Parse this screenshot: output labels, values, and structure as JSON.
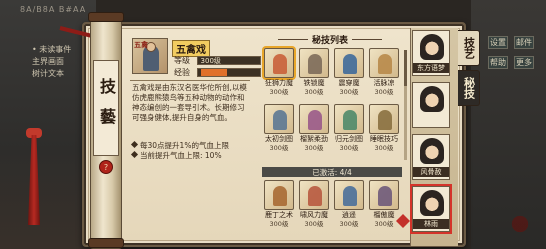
{
  "background": {
    "top_text": "8A/B8A B#AA",
    "left_list": [
      "• 未读事件",
      "主界画面",
      "树计文本"
    ],
    "right_menu": [
      "设置",
      "邮件",
      "帮助",
      "更多"
    ]
  },
  "rod": {
    "title": "技藝",
    "seal": "?"
  },
  "skill": {
    "portrait_label": "五禽",
    "name": "五禽戏",
    "level_label": "等级",
    "level_value": "300级",
    "exp_label": "经验",
    "exp_value": "",
    "exp_fill_pct": 45,
    "description": "五禽戏是由东汉名医华佗所创,以模仿虎鹿熊猿鸟等五种动物的动作和神态编创的一套导引术。长期修习可强身健体,提升自身的气血。",
    "effects": [
      "每30点提升1%的气血上限",
      "当前提升气血上限: 10%"
    ]
  },
  "secret_list": {
    "title": "秘技列表",
    "items": [
      {
        "name": "狂狮力魔",
        "level": "300级",
        "color": "#c9603a"
      },
      {
        "name": "铁锁魔",
        "level": "300级",
        "color": "#7d6b5a"
      },
      {
        "name": "震穿魔",
        "level": "300级",
        "color": "#3f6a9a"
      },
      {
        "name": "活脉凉",
        "level": "300级",
        "color": "#b88a4a"
      },
      {
        "name": "太初剑图",
        "level": "300级",
        "color": "#5c7894"
      },
      {
        "name": "榴絮柔劲",
        "level": "300级",
        "color": "#9a5a8a"
      },
      {
        "name": "归元剑图",
        "level": "300级",
        "color": "#4f8a6a"
      },
      {
        "name": "睡眠技巧",
        "level": "300级",
        "color": "#8a7040"
      }
    ],
    "activated_label": "已激活: 4/4",
    "active": [
      {
        "name": "鹿丁之术",
        "level": "300级",
        "color": "#a86a34"
      },
      {
        "name": "啸风力魔",
        "level": "300级",
        "color": "#b85a40"
      },
      {
        "name": "逍遥",
        "level": "300级",
        "color": "#4a6f9a"
      },
      {
        "name": "榴傲魔",
        "level": "300级",
        "color": "#6f5a7a"
      }
    ]
  },
  "characters": [
    {
      "name": "东方语梦"
    },
    {
      "name": ""
    },
    {
      "name": "风骨赦"
    },
    {
      "name": "林雨"
    }
  ],
  "tabs": {
    "skill": "技艺",
    "secret": "秘技"
  }
}
